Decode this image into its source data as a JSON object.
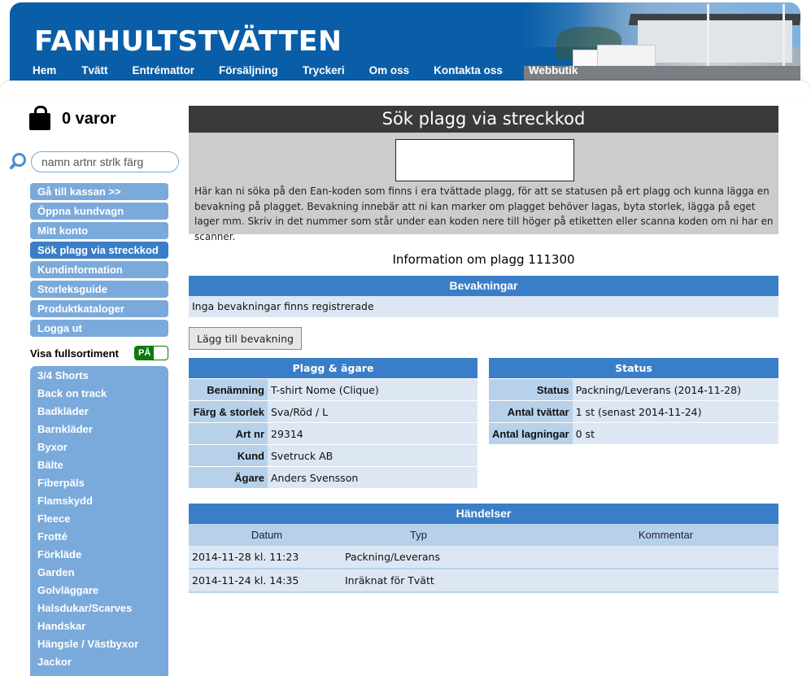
{
  "header": {
    "logo": "Fanhultstvätten",
    "nav": [
      "Hem",
      "Tvätt",
      "Entrémattor",
      "Försäljning",
      "Tryckeri",
      "Om oss",
      "Kontakta oss",
      "Webbutik"
    ]
  },
  "sidebar": {
    "cart_label": "0 varor",
    "search_placeholder": "namn artnr strlk färg",
    "menu": [
      {
        "label": "Gå till kassan >>",
        "active": false
      },
      {
        "label": "Öppna kundvagn",
        "active": false
      },
      {
        "label": "Mitt konto",
        "active": false
      },
      {
        "label": "Sök plagg via streckkod",
        "active": true
      },
      {
        "label": "Kundinformation",
        "active": false
      },
      {
        "label": "Storleksguide",
        "active": false
      },
      {
        "label": "Produktkataloger",
        "active": false
      },
      {
        "label": "Logga ut",
        "active": false
      }
    ],
    "full_assortment_label": "Visa fullsortiment",
    "full_assortment_toggle": "PÅ",
    "categories": [
      "3/4 Shorts",
      "Back on track",
      "Badkläder",
      "Barnkläder",
      "Byxor",
      "Bälte",
      "Fiberpäls",
      "Flamskydd",
      "Fleece",
      "Frotté",
      "Förkläde",
      "Garden",
      "Golvläggare",
      "Halsdukar/Scarves",
      "Handskar",
      "Hängsle / Västbyxor",
      "Jackor"
    ]
  },
  "main": {
    "search_title": "Sök plagg via streckkod",
    "barcode_value": "",
    "description": "Här kan ni söka på den Ean-koden som finns i era tvättade plagg, för att se statusen på ert plagg och kunna lägga en bevakning på plagget. Bevakning innebär att ni kan marker om plagget behöver lagas, byta storlek, lägga på eget lager mm. Skriv in det nummer som står under ean koden nere till höger på etiketten eller scanna koden om ni har en scanner.",
    "info_title": "Information om plagg 111300",
    "bevakningar": {
      "title": "Bevakningar",
      "empty_text": "Inga bevakningar finns registrerade",
      "add_button": "Lägg till bevakning"
    },
    "plagg": {
      "title": "Plagg & ägare",
      "rows": [
        {
          "key": "Benämning",
          "value": "T-shirt Nome (Clique)"
        },
        {
          "key": "Färg & storlek",
          "value": "Sva/Röd / L"
        },
        {
          "key": "Art nr",
          "value": "29314"
        },
        {
          "key": "Kund",
          "value": "Svetruck AB"
        },
        {
          "key": "Ägare",
          "value": "Anders Svensson"
        }
      ]
    },
    "status": {
      "title": "Status",
      "rows": [
        {
          "key": "Status",
          "value": "Packning/Leverans (2014-11-28)"
        },
        {
          "key": "Antal tvättar",
          "value": "1 st (senast 2014-11-24)"
        },
        {
          "key": "Antal lagningar",
          "value": "0 st"
        }
      ]
    },
    "handelser": {
      "title": "Händelser",
      "columns": [
        "Datum",
        "Typ",
        "Kommentar"
      ],
      "rows": [
        {
          "datum": "2014-11-28 kl. 11:23",
          "typ": "Packning/Leverans",
          "kommentar": ""
        },
        {
          "datum": "2014-11-24 kl. 14:35",
          "typ": "Inräknat för Tvätt",
          "kommentar": ""
        }
      ]
    }
  }
}
